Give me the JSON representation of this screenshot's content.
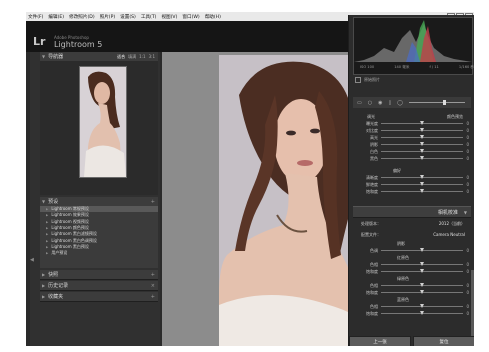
{
  "menu": [
    "文件(F)",
    "编辑(E)",
    "修改照片(D)",
    "照片(P)",
    "设置(S)",
    "工具(T)",
    "视图(V)",
    "窗口(W)",
    "帮助(H)"
  ],
  "identity": {
    "logo": "Lr",
    "subtitle": "Adobe Photoshop",
    "app_name": "Lightroom 5"
  },
  "left_panel": {
    "navigator": {
      "title": "导航器",
      "zoom": [
        "适合",
        "填满",
        "1:1",
        "3:1"
      ],
      "zoom_selected": 0
    },
    "presets": {
      "title": "预设",
      "items": [
        "Lightroom 常规预设",
        "Lightroom 效果预设",
        "Lightroom 视频预设",
        "Lightroom 颜色预设",
        "Lightroom 黑白滤镜预设",
        "Lightroom 黑白色调预设",
        "Lightroom 黑白预设",
        "用户预设"
      ],
      "selected_index": 0
    },
    "snapshots": {
      "title": "快照"
    },
    "history": {
      "title": "历史记录"
    },
    "collections": {
      "title": "收藏夹"
    }
  },
  "right_panel": {
    "histogram_labels": [
      "ISO 100",
      "140 毫米",
      "f / 11",
      "1/160 秒"
    ],
    "original_photo_label": "原始照片",
    "tone_section": {
      "header_left": "调光",
      "header_right": "颜色预览",
      "rows": [
        {
          "label": "曝光度",
          "value": "0",
          "pos": 0.5
        },
        {
          "label": "对比度",
          "value": "0",
          "pos": 0.5
        },
        {
          "label": "高光",
          "value": "0",
          "pos": 0.5
        },
        {
          "label": "阴影",
          "value": "0",
          "pos": 0.5
        },
        {
          "label": "白色",
          "value": "0",
          "pos": 0.5
        },
        {
          "label": "黑色",
          "value": "0",
          "pos": 0.5
        }
      ]
    },
    "presence_section": {
      "header": "偏好",
      "rows": [
        {
          "label": "清晰度",
          "value": "0",
          "pos": 0.5
        },
        {
          "label": "鲜艳度",
          "value": "0",
          "pos": 0.5
        },
        {
          "label": "饱和度",
          "value": "0",
          "pos": 0.5
        }
      ]
    },
    "camera_calibration": {
      "title": "相机校准",
      "process_label": "处理版本：",
      "process_value": "2012（当前）",
      "profile_label": "配置文件：",
      "profile_value": "Camera Neutral",
      "shadows_header": "阴影",
      "shadow_rows": [
        {
          "label": "色调",
          "value": "0",
          "pos": 0.5
        }
      ],
      "red_header": "红原色",
      "red_rows": [
        {
          "label": "色相",
          "value": "0",
          "pos": 0.5
        },
        {
          "label": "饱和度",
          "value": "0",
          "pos": 0.5
        }
      ],
      "green_header": "绿原色",
      "green_rows": [
        {
          "label": "色相",
          "value": "0",
          "pos": 0.5
        },
        {
          "label": "饱和度",
          "value": "0",
          "pos": 0.5
        }
      ],
      "blue_header": "蓝原色",
      "blue_rows": [
        {
          "label": "色相",
          "value": "0",
          "pos": 0.5
        },
        {
          "label": "饱和度",
          "value": "0",
          "pos": 0.5
        }
      ]
    },
    "buttons": {
      "previous": "上一张",
      "reset": "复位"
    }
  }
}
